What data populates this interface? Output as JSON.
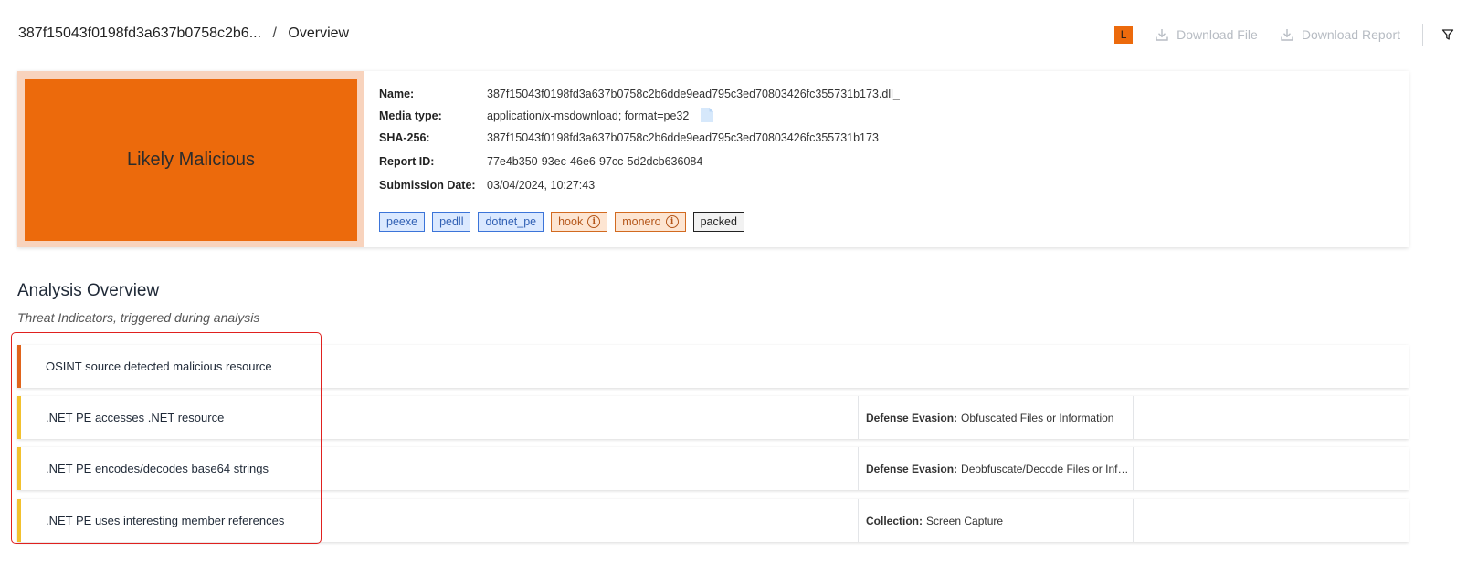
{
  "breadcrumb": {
    "file": "387f15043f0198fd3a637b0758c2b6...",
    "separator": "/",
    "current": "Overview"
  },
  "header": {
    "avatar_letter": "L",
    "download_file": "Download File",
    "download_report": "Download Report",
    "icons": {
      "download": "download-icon",
      "filter": "filter-icon"
    }
  },
  "summary": {
    "verdict": "Likely Malicious",
    "colors": {
      "verdict": "#ec6a0c",
      "verdict_frame": "#f8d3bd"
    },
    "fields": [
      {
        "label": "Name:",
        "value": "387f15043f0198fd3a637b0758c2b6dde9ead795c3ed70803426fc355731b173.dll_"
      },
      {
        "label": "Media type:",
        "value": "application/x-msdownload; format=pe32"
      },
      {
        "label": "SHA-256:",
        "value": "387f15043f0198fd3a637b0758c2b6dde9ead795c3ed70803426fc355731b173"
      },
      {
        "label": "Report ID:",
        "value": "77e4b350-93ec-46e6-97cc-5d2dcb636084"
      },
      {
        "label": "Submission Date:",
        "value": "03/04/2024, 10:27:43"
      }
    ],
    "tags": [
      {
        "label": "peexe",
        "style": "blue"
      },
      {
        "label": "pedll",
        "style": "blue"
      },
      {
        "label": "dotnet_pe",
        "style": "blue"
      },
      {
        "label": "hook",
        "style": "orange",
        "info": true
      },
      {
        "label": "monero",
        "style": "orange",
        "info": true
      },
      {
        "label": "packed",
        "style": "dark"
      }
    ]
  },
  "analysis": {
    "title": "Analysis Overview",
    "subtitle": "Threat Indicators, triggered during analysis",
    "indicators": [
      {
        "name": "OSINT source detected malicious resource",
        "color": "#e0641c",
        "tactic": "",
        "technique": ""
      },
      {
        "name": ".NET PE accesses .NET resource",
        "color": "#f2c12e",
        "tactic": "Defense Evasion:",
        "technique": "Obfuscated Files or Information"
      },
      {
        "name": ".NET PE encodes/decodes base64 strings",
        "color": "#f2c12e",
        "tactic": "Defense Evasion:",
        "technique": "Deobfuscate/Decode Files or Information"
      },
      {
        "name": ".NET PE uses interesting member references",
        "color": "#f2c12e",
        "tactic": "Collection:",
        "technique": "Screen Capture"
      }
    ]
  }
}
